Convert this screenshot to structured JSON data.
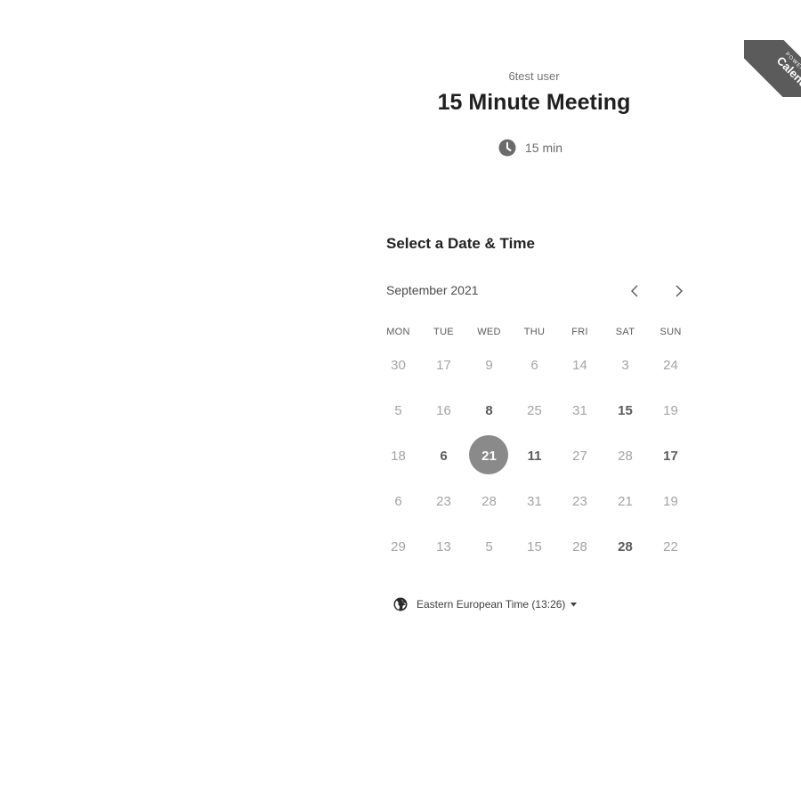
{
  "badge": {
    "line1": "POWERED BY",
    "line2": "Calendly"
  },
  "event": {
    "owner": "6test user",
    "title": "15 Minute Meeting",
    "duration": "15 min"
  },
  "scheduler": {
    "heading": "Select a Date & Time",
    "month": "September 2021",
    "weekdays": [
      "MON",
      "TUE",
      "WED",
      "THU",
      "FRI",
      "SAT",
      "SUN"
    ],
    "weeks": [
      [
        {
          "d": "30"
        },
        {
          "d": "17"
        },
        {
          "d": "9"
        },
        {
          "d": "6"
        },
        {
          "d": "14"
        },
        {
          "d": "3"
        },
        {
          "d": "24"
        }
      ],
      [
        {
          "d": "5"
        },
        {
          "d": "16"
        },
        {
          "d": "8",
          "available": true
        },
        {
          "d": "25"
        },
        {
          "d": "31"
        },
        {
          "d": "15",
          "available": true
        },
        {
          "d": "19"
        }
      ],
      [
        {
          "d": "18"
        },
        {
          "d": "6",
          "available": true
        },
        {
          "d": "21",
          "selected": true
        },
        {
          "d": "11",
          "available": true
        },
        {
          "d": "27"
        },
        {
          "d": "28"
        },
        {
          "d": "17",
          "available": true
        }
      ],
      [
        {
          "d": "6"
        },
        {
          "d": "23"
        },
        {
          "d": "28"
        },
        {
          "d": "31"
        },
        {
          "d": "23"
        },
        {
          "d": "21"
        },
        {
          "d": "19"
        }
      ],
      [
        {
          "d": "29"
        },
        {
          "d": "13"
        },
        {
          "d": "5"
        },
        {
          "d": "15"
        },
        {
          "d": "28"
        },
        {
          "d": "28",
          "available": true
        },
        {
          "d": "22"
        }
      ]
    ],
    "timezone": "Eastern European Time (13:26)"
  },
  "colors": {
    "selected_day_bg": "#8a8a8a",
    "badge_bg": "#5b5b5b"
  }
}
